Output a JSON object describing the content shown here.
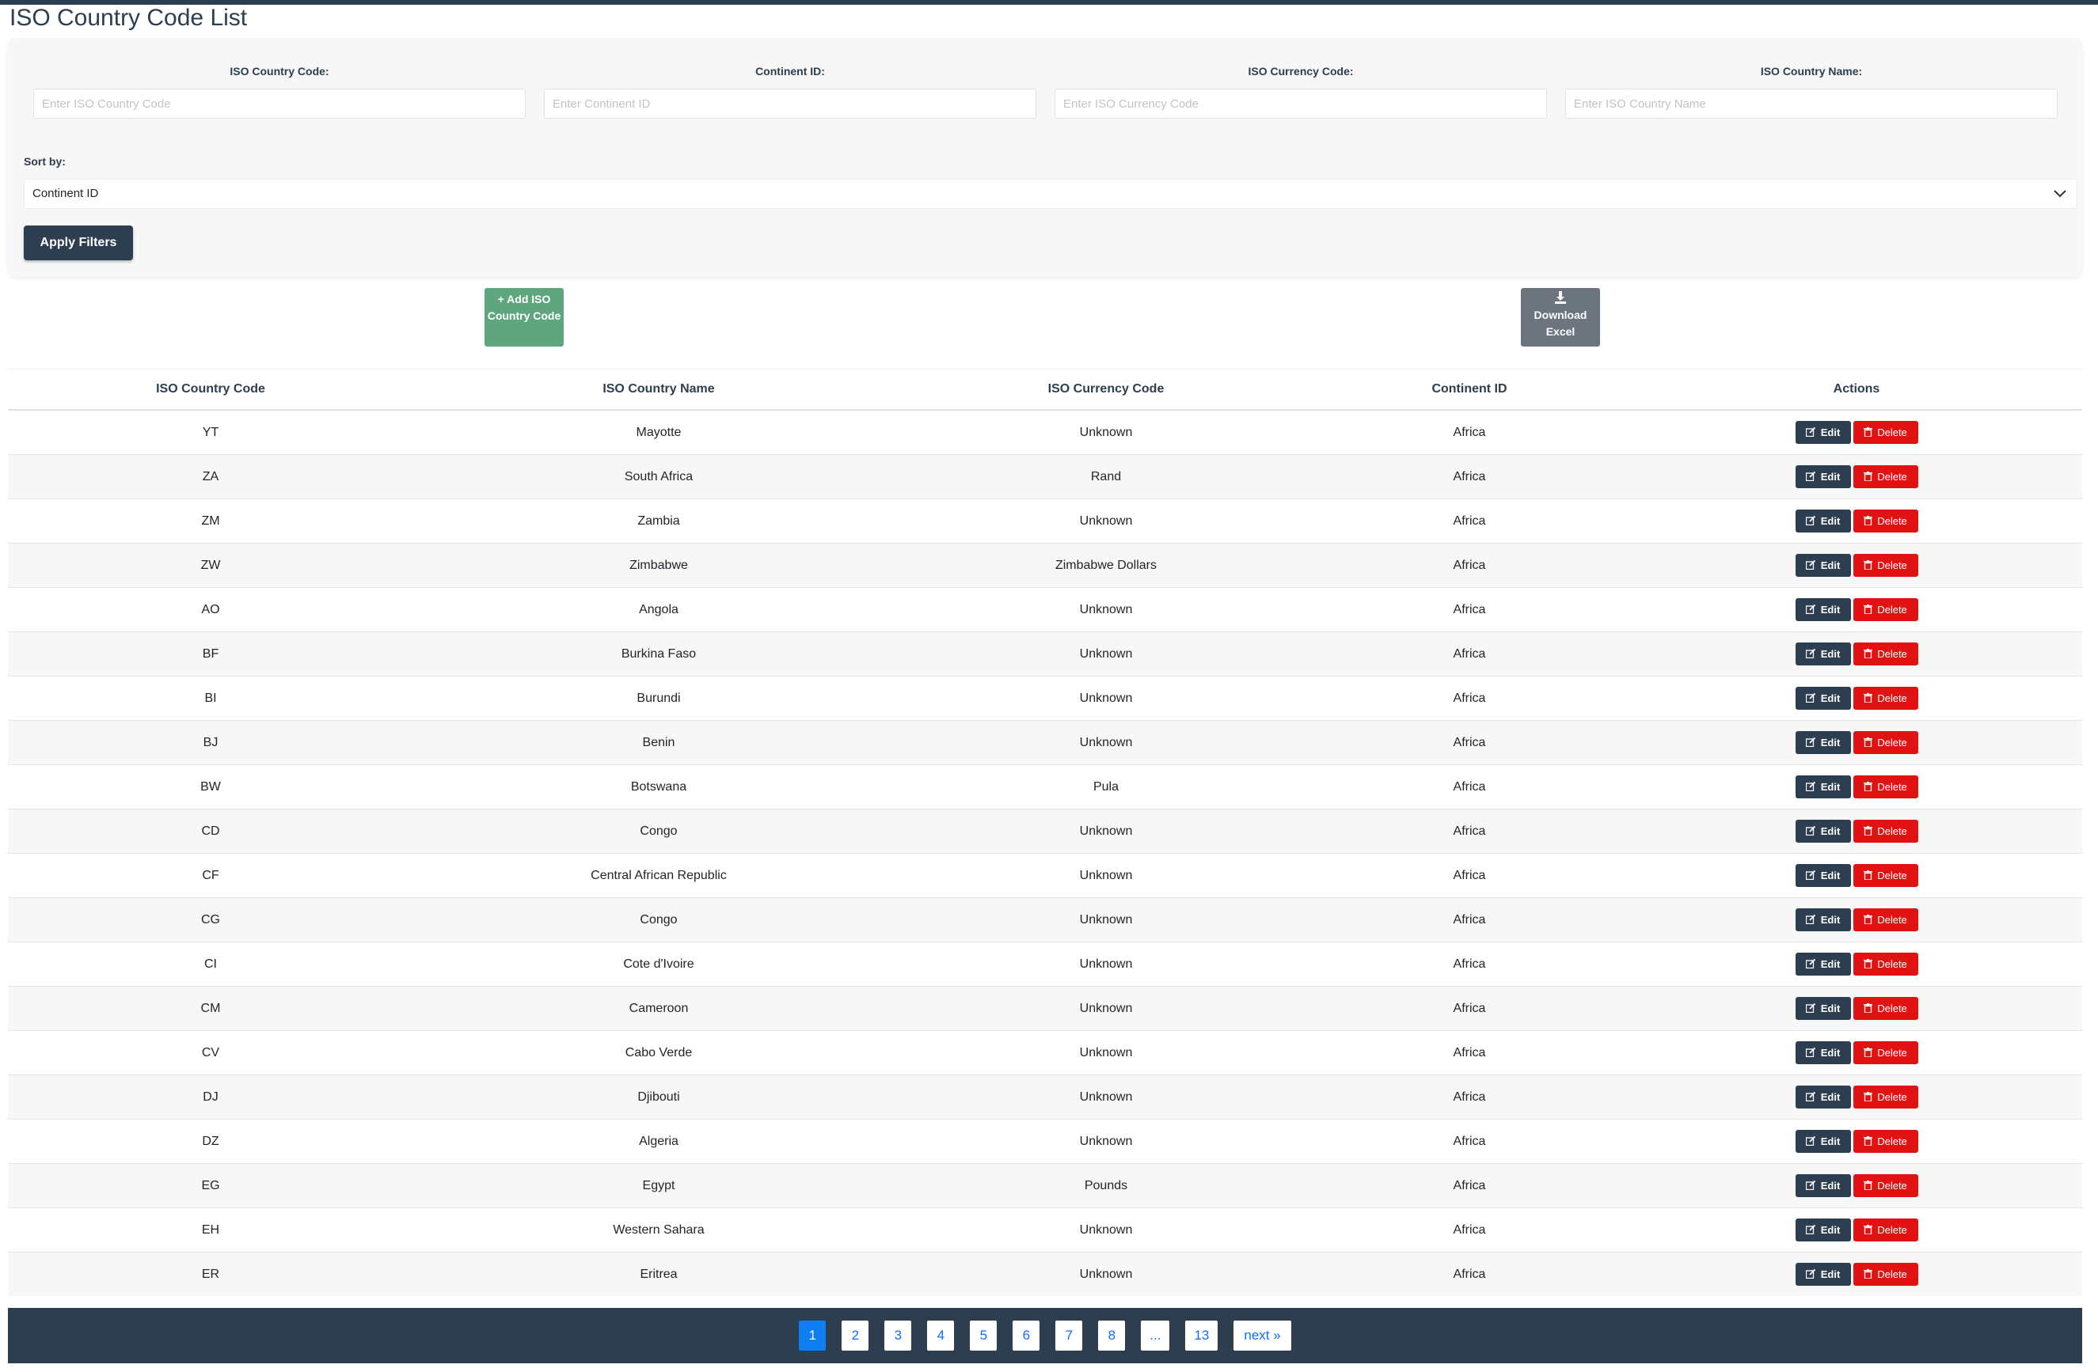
{
  "title": "ISO Country Code List",
  "filters": {
    "country_code": {
      "label": "ISO Country Code:",
      "placeholder": "Enter ISO Country Code",
      "value": ""
    },
    "continent_id": {
      "label": "Continent ID:",
      "placeholder": "Enter Continent ID",
      "value": ""
    },
    "currency_code": {
      "label": "ISO Currency Code:",
      "placeholder": "Enter ISO Currency Code",
      "value": ""
    },
    "country_name": {
      "label": "ISO Country Name:",
      "placeholder": "Enter ISO Country Name",
      "value": ""
    }
  },
  "sort": {
    "label": "Sort by:",
    "selected": "Continent ID"
  },
  "apply_label": "Apply Filters",
  "add_button": {
    "label": "Add ISO Country Code",
    "icon": "plus-icon"
  },
  "download_button": {
    "label": "Download Excel",
    "icon": "download-icon"
  },
  "table": {
    "headers": [
      "ISO Country Code",
      "ISO Country Name",
      "ISO Currency Code",
      "Continent ID",
      "Actions"
    ],
    "edit_label": "Edit",
    "delete_label": "Delete",
    "rows": [
      [
        "YT",
        "Mayotte",
        "Unknown",
        "Africa"
      ],
      [
        "ZA",
        "South Africa",
        "Rand",
        "Africa"
      ],
      [
        "ZM",
        "Zambia",
        "Unknown",
        "Africa"
      ],
      [
        "ZW",
        "Zimbabwe",
        "Zimbabwe Dollars",
        "Africa"
      ],
      [
        "AO",
        "Angola",
        "Unknown",
        "Africa"
      ],
      [
        "BF",
        "Burkina Faso",
        "Unknown",
        "Africa"
      ],
      [
        "BI",
        "Burundi",
        "Unknown",
        "Africa"
      ],
      [
        "BJ",
        "Benin",
        "Unknown",
        "Africa"
      ],
      [
        "BW",
        "Botswana",
        "Pula",
        "Africa"
      ],
      [
        "CD",
        "Congo",
        "Unknown",
        "Africa"
      ],
      [
        "CF",
        "Central African Republic",
        "Unknown",
        "Africa"
      ],
      [
        "CG",
        "Congo",
        "Unknown",
        "Africa"
      ],
      [
        "CI",
        "Cote d'Ivoire",
        "Unknown",
        "Africa"
      ],
      [
        "CM",
        "Cameroon",
        "Unknown",
        "Africa"
      ],
      [
        "CV",
        "Cabo Verde",
        "Unknown",
        "Africa"
      ],
      [
        "DJ",
        "Djibouti",
        "Unknown",
        "Africa"
      ],
      [
        "DZ",
        "Algeria",
        "Unknown",
        "Africa"
      ],
      [
        "EG",
        "Egypt",
        "Pounds",
        "Africa"
      ],
      [
        "EH",
        "Western Sahara",
        "Unknown",
        "Africa"
      ],
      [
        "ER",
        "Eritrea",
        "Unknown",
        "Africa"
      ]
    ]
  },
  "pagination": {
    "pages": [
      "1",
      "2",
      "3",
      "4",
      "5",
      "6",
      "7",
      "8",
      "...",
      "13"
    ],
    "current": "1",
    "next_label": "next »"
  },
  "colors": {
    "primary": "#2c3e50",
    "add": "#5fa67e",
    "download": "#6c757d",
    "delete": "#e01212",
    "active_page": "#0d7ff2"
  }
}
